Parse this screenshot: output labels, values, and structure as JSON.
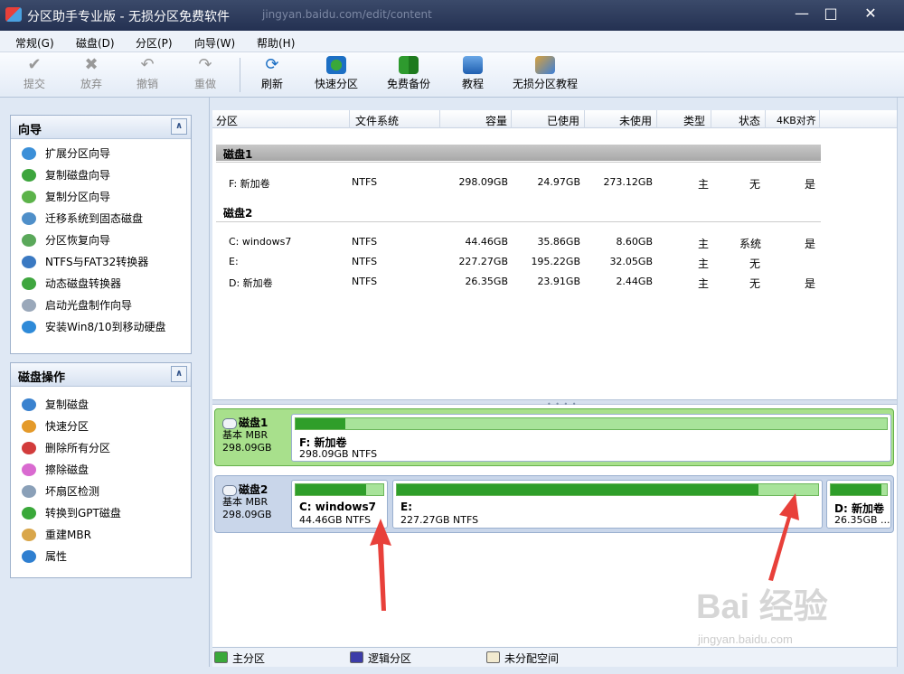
{
  "window": {
    "title": "分区助手专业版 - 无损分区免费软件",
    "url": "jingyan.baidu.com/edit/content"
  },
  "menu": [
    "常规(G)",
    "磁盘(D)",
    "分区(P)",
    "向导(W)",
    "帮助(H)"
  ],
  "toolbar": {
    "commit": "提交",
    "discard": "放弃",
    "undo": "撤销",
    "redo": "重做",
    "refresh": "刷新",
    "quick_partition": "快速分区",
    "free_backup": "免费备份",
    "tutorial": "教程",
    "lossless_tutorial": "无损分区教程"
  },
  "wizard_panel": {
    "title": "向导",
    "items": [
      "扩展分区向导",
      "复制磁盘向导",
      "复制分区向导",
      "迁移系统到固态磁盘",
      "分区恢复向导",
      "NTFS与FAT32转换器",
      "动态磁盘转换器",
      "启动光盘制作向导",
      "安装Win8/10到移动硬盘"
    ]
  },
  "disk_panel": {
    "title": "磁盘操作",
    "items": [
      "复制磁盘",
      "快速分区",
      "删除所有分区",
      "擦除磁盘",
      "坏扇区检测",
      "转换到GPT磁盘",
      "重建MBR",
      "属性"
    ]
  },
  "columns": [
    "分区",
    "文件系统",
    "容量",
    "已使用",
    "未使用",
    "类型",
    "状态",
    "4KB对齐"
  ],
  "disk_groups": [
    "磁盘1",
    "磁盘2"
  ],
  "rows": [
    {
      "part": "F: 新加卷",
      "fs": "NTFS",
      "cap": "298.09GB",
      "used": "24.97GB",
      "free": "273.12GB",
      "type": "主",
      "status": "无",
      "align": "是"
    },
    {
      "part": "C: windows7",
      "fs": "NTFS",
      "cap": "44.46GB",
      "used": "35.86GB",
      "free": "8.60GB",
      "type": "主",
      "status": "系统",
      "align": "是"
    },
    {
      "part": "E:",
      "fs": "NTFS",
      "cap": "227.27GB",
      "used": "195.22GB",
      "free": "32.05GB",
      "type": "主",
      "status": "无",
      "align": ""
    },
    {
      "part": "D: 新加卷",
      "fs": "NTFS",
      "cap": "26.35GB",
      "used": "23.91GB",
      "free": "2.44GB",
      "type": "主",
      "status": "无",
      "align": "是"
    }
  ],
  "map": {
    "disk1": {
      "name": "磁盘1",
      "type": "基本 MBR",
      "size": "298.09GB",
      "part": {
        "name": "F: 新加卷",
        "info": "298.09GB NTFS",
        "used_fraction": 0.084
      }
    },
    "disk2": {
      "name": "磁盘2",
      "type": "基本 MBR",
      "size": "298.09GB",
      "parts": [
        {
          "name": "C: windows7",
          "info": "44.46GB NTFS",
          "used_fraction": 0.807
        },
        {
          "name": "E:",
          "info": "227.27GB NTFS",
          "used_fraction": 0.859
        },
        {
          "name": "D: 新加卷",
          "info": "26.35GB ...",
          "used_fraction": 0.907
        }
      ]
    }
  },
  "legend": {
    "primary": "主分区",
    "logical": "逻辑分区",
    "unallocated": "未分配空间"
  },
  "colors": {
    "primary": "#3aa83a",
    "logical": "#3c3ca8",
    "unallocated": "#f2ead0",
    "selected_disk": "#a8e08c"
  },
  "watermark": {
    "brand": "Bai 经验",
    "url": "jingyan.baidu.com"
  }
}
